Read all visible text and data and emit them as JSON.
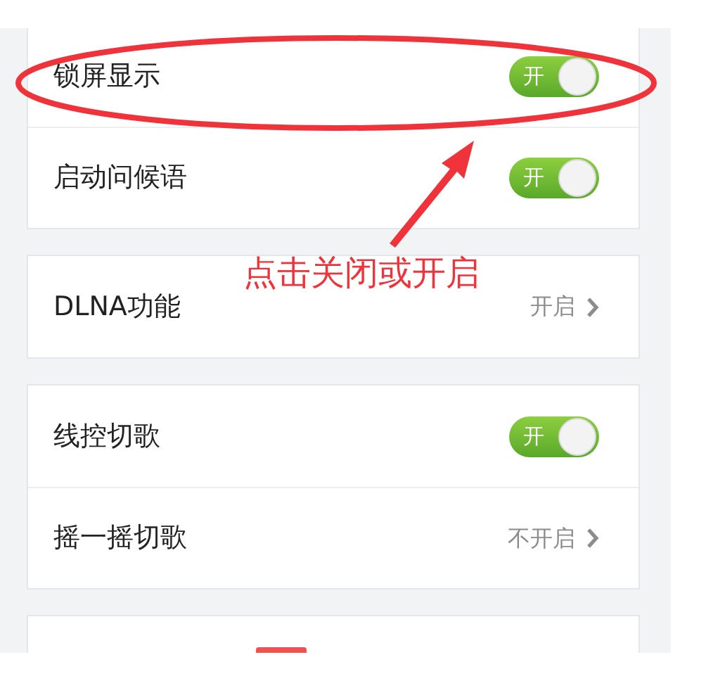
{
  "sections": [
    {
      "rows": [
        {
          "kind": "toggle",
          "label": "锁屏显示",
          "on": true,
          "switch_text": "开"
        },
        {
          "kind": "toggle",
          "label": "启动问候语",
          "on": true,
          "switch_text": "开"
        }
      ]
    },
    {
      "rows": [
        {
          "kind": "link",
          "label": "DLNA功能",
          "value": "开启"
        }
      ]
    },
    {
      "rows": [
        {
          "kind": "toggle",
          "label": "线控切歌",
          "on": true,
          "switch_text": "开"
        },
        {
          "kind": "link",
          "label": "摇一摇切歌",
          "value": "不开启"
        }
      ]
    },
    {
      "rows": [
        {
          "kind": "badge"
        }
      ]
    }
  ],
  "annotation": {
    "text": "点击关闭或开启"
  }
}
